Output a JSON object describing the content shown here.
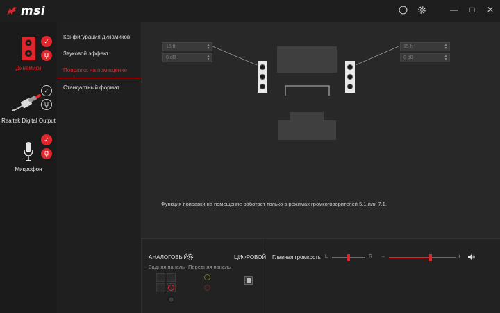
{
  "app": {
    "brand": "msi"
  },
  "titlebar": {
    "info_icon": "info-icon",
    "settings_icon": "gear-icon",
    "minimize": "—",
    "maximize": "□",
    "close": "✕"
  },
  "devices": [
    {
      "label": "Динамики",
      "active": true,
      "icon": "speaker-icon",
      "status": "checked"
    },
    {
      "label": "Realtek Digital Output",
      "active": false,
      "icon": "digital-output-plug-icon",
      "status": "outline"
    },
    {
      "label": "Микрофон",
      "active": false,
      "icon": "microphone-icon",
      "status": "checked"
    }
  ],
  "menu": {
    "items": [
      {
        "label": "Конфигурация динамиков"
      },
      {
        "label": "Звуковой эффект"
      },
      {
        "label": "Поправка на помещение",
        "active": true
      },
      {
        "label": "Стандартный формат"
      }
    ]
  },
  "room": {
    "left_distance": "15 ft",
    "left_gain": "0 dB",
    "right_distance": "15 ft",
    "right_gain": "0 dB",
    "note": "Функция поправки на помещение работает только в режимах громкоговорителей 5.1 или 7.1."
  },
  "connectors": {
    "analog_title": "АНАЛОГОВЫЙ",
    "digital_title": "ЦИФРОВОЙ",
    "rear_panel": "Задняя панель",
    "front_panel": "Передняя панель"
  },
  "volume": {
    "label": "Главная громкость",
    "balance_left": "L",
    "balance_right": "R",
    "minus": "−",
    "plus": "+",
    "balance": 0.5,
    "level": 0.62
  },
  "colors": {
    "accent": "#e0262c",
    "background": "#252525"
  }
}
